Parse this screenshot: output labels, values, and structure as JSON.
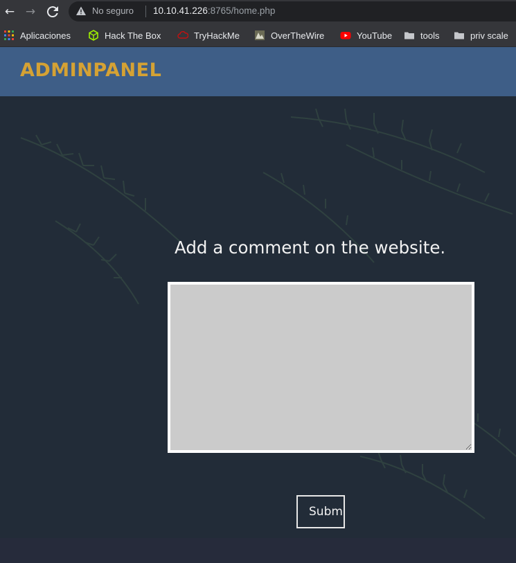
{
  "browser": {
    "security_label": "No seguro",
    "url_host": "10.10.41.226",
    "url_rest": ":8765/home.php"
  },
  "bookmarks": [
    {
      "label": "Aplicaciones",
      "icon": "apps-grid-icon"
    },
    {
      "label": "Hack The Box",
      "icon": "hackthebox-cube-icon"
    },
    {
      "label": "TryHackMe",
      "icon": "tryhackme-cloud-icon"
    },
    {
      "label": "OverTheWire",
      "icon": "overthewire-icon"
    },
    {
      "label": "YouTube",
      "icon": "youtube-icon"
    },
    {
      "label": "tools",
      "icon": "folder-icon"
    },
    {
      "label": "priv scale",
      "icon": "folder-icon"
    }
  ],
  "site": {
    "brand": "ADMINPANEL",
    "prompt": "Add a comment on the website.",
    "comment_value": "",
    "submit_label": "Submi"
  },
  "colors": {
    "header_bg": "#3e5e87",
    "brand": "#d5a234",
    "hero_bg": "#222c38",
    "textarea_bg": "#cbcbcb"
  }
}
